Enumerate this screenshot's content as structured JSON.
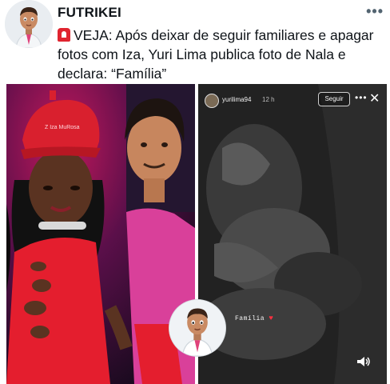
{
  "header": {
    "account_name": "FUTRIKEI",
    "more_label": "•••"
  },
  "tweet": {
    "text": "VEJA: Após deixar de seguir familiares e apagar fotos com Iza, Yuri Lima publica foto de Nala e declara: “Família”"
  },
  "media": {
    "left_photo": {
      "cap_text": "Z Iza MuRosa"
    },
    "story": {
      "username": "yurilima94",
      "time": "12 h",
      "follow_label": "Seguir",
      "more_label": "•••",
      "close_label": "✕",
      "caption": "Família",
      "caption_emoji": "♥"
    }
  },
  "colors": {
    "siren": "#e0242f",
    "heart": "#ff3040",
    "dress": "#e41e2e",
    "cap": "#d9202e"
  },
  "icons": [
    "siren-emoji-icon",
    "sound-icon",
    "close-icon",
    "more-icon"
  ]
}
